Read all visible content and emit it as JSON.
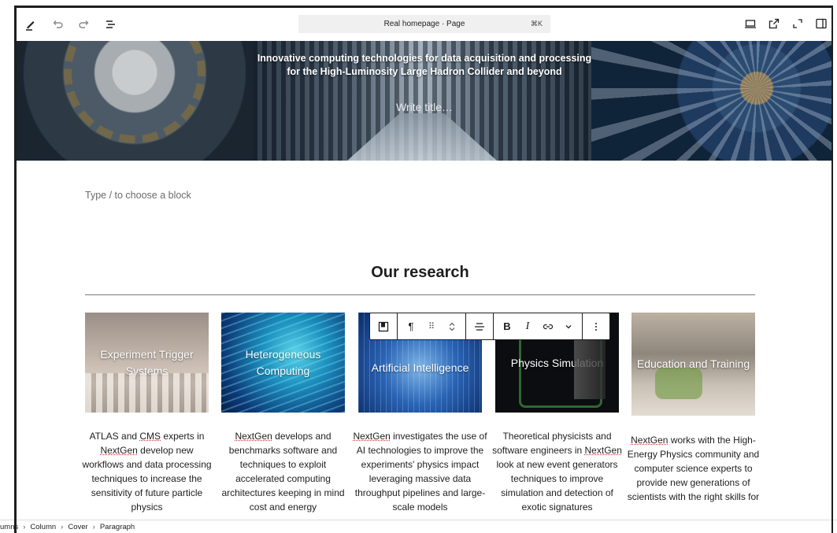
{
  "topbar": {
    "command_label": "Real homepage · Page",
    "command_shortcut": "⌘K"
  },
  "hero": {
    "line1": "Innovative computing technologies for data acquisition and processing",
    "line2": "for the High-Luminosity Large Hadron Collider and beyond",
    "title_placeholder": "Write title…"
  },
  "editor": {
    "block_placeholder": "Type / to choose a block"
  },
  "section": {
    "title": "Our research"
  },
  "cards": [
    {
      "label": "Experiment Trigger Systems",
      "desc_pre": "ATLAS and ",
      "desc_u1": "CMS",
      "desc_mid": " experts in ",
      "desc_u2": "NextGen",
      "desc_post": " develop new workflows and data processing techniques to increase the sensitivity of future particle physics"
    },
    {
      "label": "Heterogeneous Computing",
      "desc_u1": "NextGen",
      "desc_post": " develops and benchmarks software and techniques to exploit accelerated computing architectures keeping in mind cost and energy"
    },
    {
      "label": "Artificial Intelligence",
      "desc_u1": "NextGen",
      "desc_post": " investigates the use of AI technologies to improve the experiments' physics impact leveraging massive data throughput pipelines and large-scale models"
    },
    {
      "label": "Physics Simulation",
      "desc_pre": "Theoretical physicists and software engineers in ",
      "desc_u1": "NextGen",
      "desc_post": " look at new event generators techniques to improve simulation and detection of exotic signatures"
    },
    {
      "label": "Education and Training",
      "desc_u1": "NextGen",
      "desc_post": " works with the High-Energy Physics community and computer science experts to provide new generations of scientists with the right skills for"
    }
  ],
  "block_toolbar": {
    "paragraph_symbol": "¶",
    "drag_symbol": "⠿",
    "bold": "B",
    "italic": "I"
  },
  "breadcrumb": {
    "items": [
      "umns",
      "Column",
      "Cover",
      "Paragraph"
    ],
    "separator": "›"
  }
}
